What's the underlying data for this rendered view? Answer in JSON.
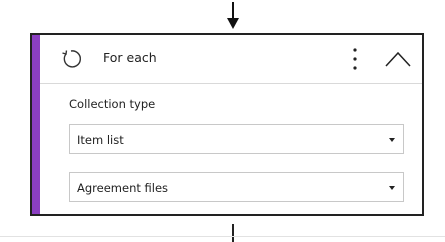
{
  "card": {
    "title": "For each",
    "accent_color": "#8b3fc2",
    "icons": {
      "loop": "loop-arrow-icon",
      "more": "vertical-ellipsis-icon",
      "collapse": "chevron-up-icon"
    }
  },
  "fields": {
    "collection_type_label": "Collection type",
    "collection_type_value": "Item list",
    "source_value": "Agreement files"
  }
}
